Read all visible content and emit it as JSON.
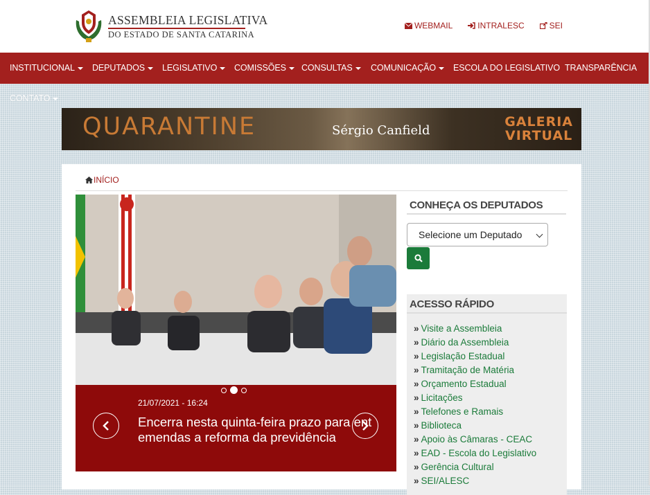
{
  "header": {
    "logo_line1": "ASSEMBLEIA LEGISLATIVA",
    "logo_line2": "DO ESTADO DE SANTA CATARINA",
    "links": [
      {
        "icon": "envelope-icon",
        "label": "WEBMAIL"
      },
      {
        "icon": "sign-in-icon",
        "label": "INTRALESC"
      },
      {
        "icon": "external-link-icon",
        "label": "SEI"
      }
    ]
  },
  "nav": {
    "items": [
      {
        "label": "INSTITUCIONAL",
        "dropdown": true
      },
      {
        "label": "DEPUTADOS",
        "dropdown": true
      },
      {
        "label": "LEGISLATIVO",
        "dropdown": true
      },
      {
        "label": "COMISSÕES",
        "dropdown": true
      },
      {
        "label": "CONSULTAS",
        "dropdown": true
      },
      {
        "label": "COMUNICAÇÃO",
        "dropdown": true
      },
      {
        "label": "ESCOLA DO LEGISLATIVO",
        "dropdown": false
      },
      {
        "label": "TRANSPARÊNCIA",
        "dropdown": false
      }
    ],
    "row2": [
      {
        "label": "CONTATO",
        "dropdown": true
      }
    ]
  },
  "banner": {
    "title": "QUARANTINE",
    "artist": "Sérgio Canfield",
    "gallery_line1": "GALERIA",
    "gallery_line2": "VIRTUAL"
  },
  "breadcrumb": {
    "label": "INÍCIO"
  },
  "slider": {
    "date": "21/07/2021 - 16:24",
    "title_line1": "Encerra nesta quinta-feira prazo para ent",
    "title_line2": "emendas a reforma da previdência",
    "prev_icon": "chevron-left-icon",
    "next_icon": "chevron-right-icon",
    "slides": 3,
    "active_slide": 2
  },
  "deputados": {
    "heading": "CONHEÇA OS DEPUTADOS",
    "select_value": "Selecione um Deputado",
    "search_icon": "search-icon"
  },
  "acesso": {
    "heading": "ACESSO RÁPIDO",
    "items": [
      "Visite a Assembleia",
      "Diário da Assembleia",
      "Legislação Estadual",
      "Tramitação de Matéria",
      "Orçamento Estadual",
      "Licitações",
      "Telefones e Ramais",
      "Biblioteca",
      "Apoio às Câmaras - CEAC",
      "EAD - Escola do Legislativo",
      "Gerência Cultural",
      "SEI/ALESC"
    ]
  },
  "colors": {
    "brand_red": "#a3201e",
    "caption_red": "#8e0a0a",
    "link_green": "#1b7b3a"
  }
}
